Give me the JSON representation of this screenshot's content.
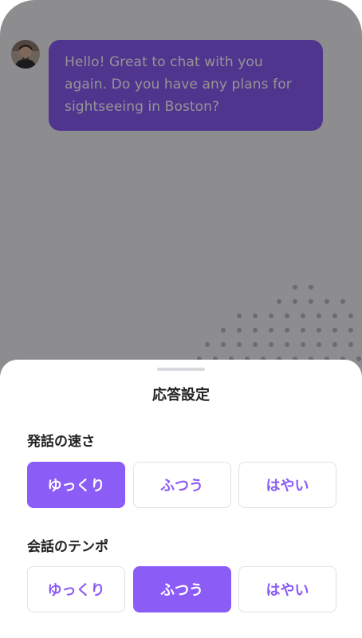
{
  "chat": {
    "message": "Hello! Great to chat with you again. Do you have any plans for sightseeing in Boston?",
    "avatar_icon": "person-avatar"
  },
  "sheet": {
    "title": "応答設定",
    "speed": {
      "label": "発話の速さ",
      "options": [
        "ゆっくり",
        "ふつう",
        "はやい"
      ],
      "selected": "ゆっくり"
    },
    "tempo": {
      "label": "会話のテンポ",
      "options": [
        "ゆっくり",
        "ふつう",
        "はやい"
      ],
      "selected": "ふつう"
    }
  },
  "colors": {
    "accent": "#8b5cf6",
    "overlay": "rgba(0,0,0,0.42)"
  }
}
